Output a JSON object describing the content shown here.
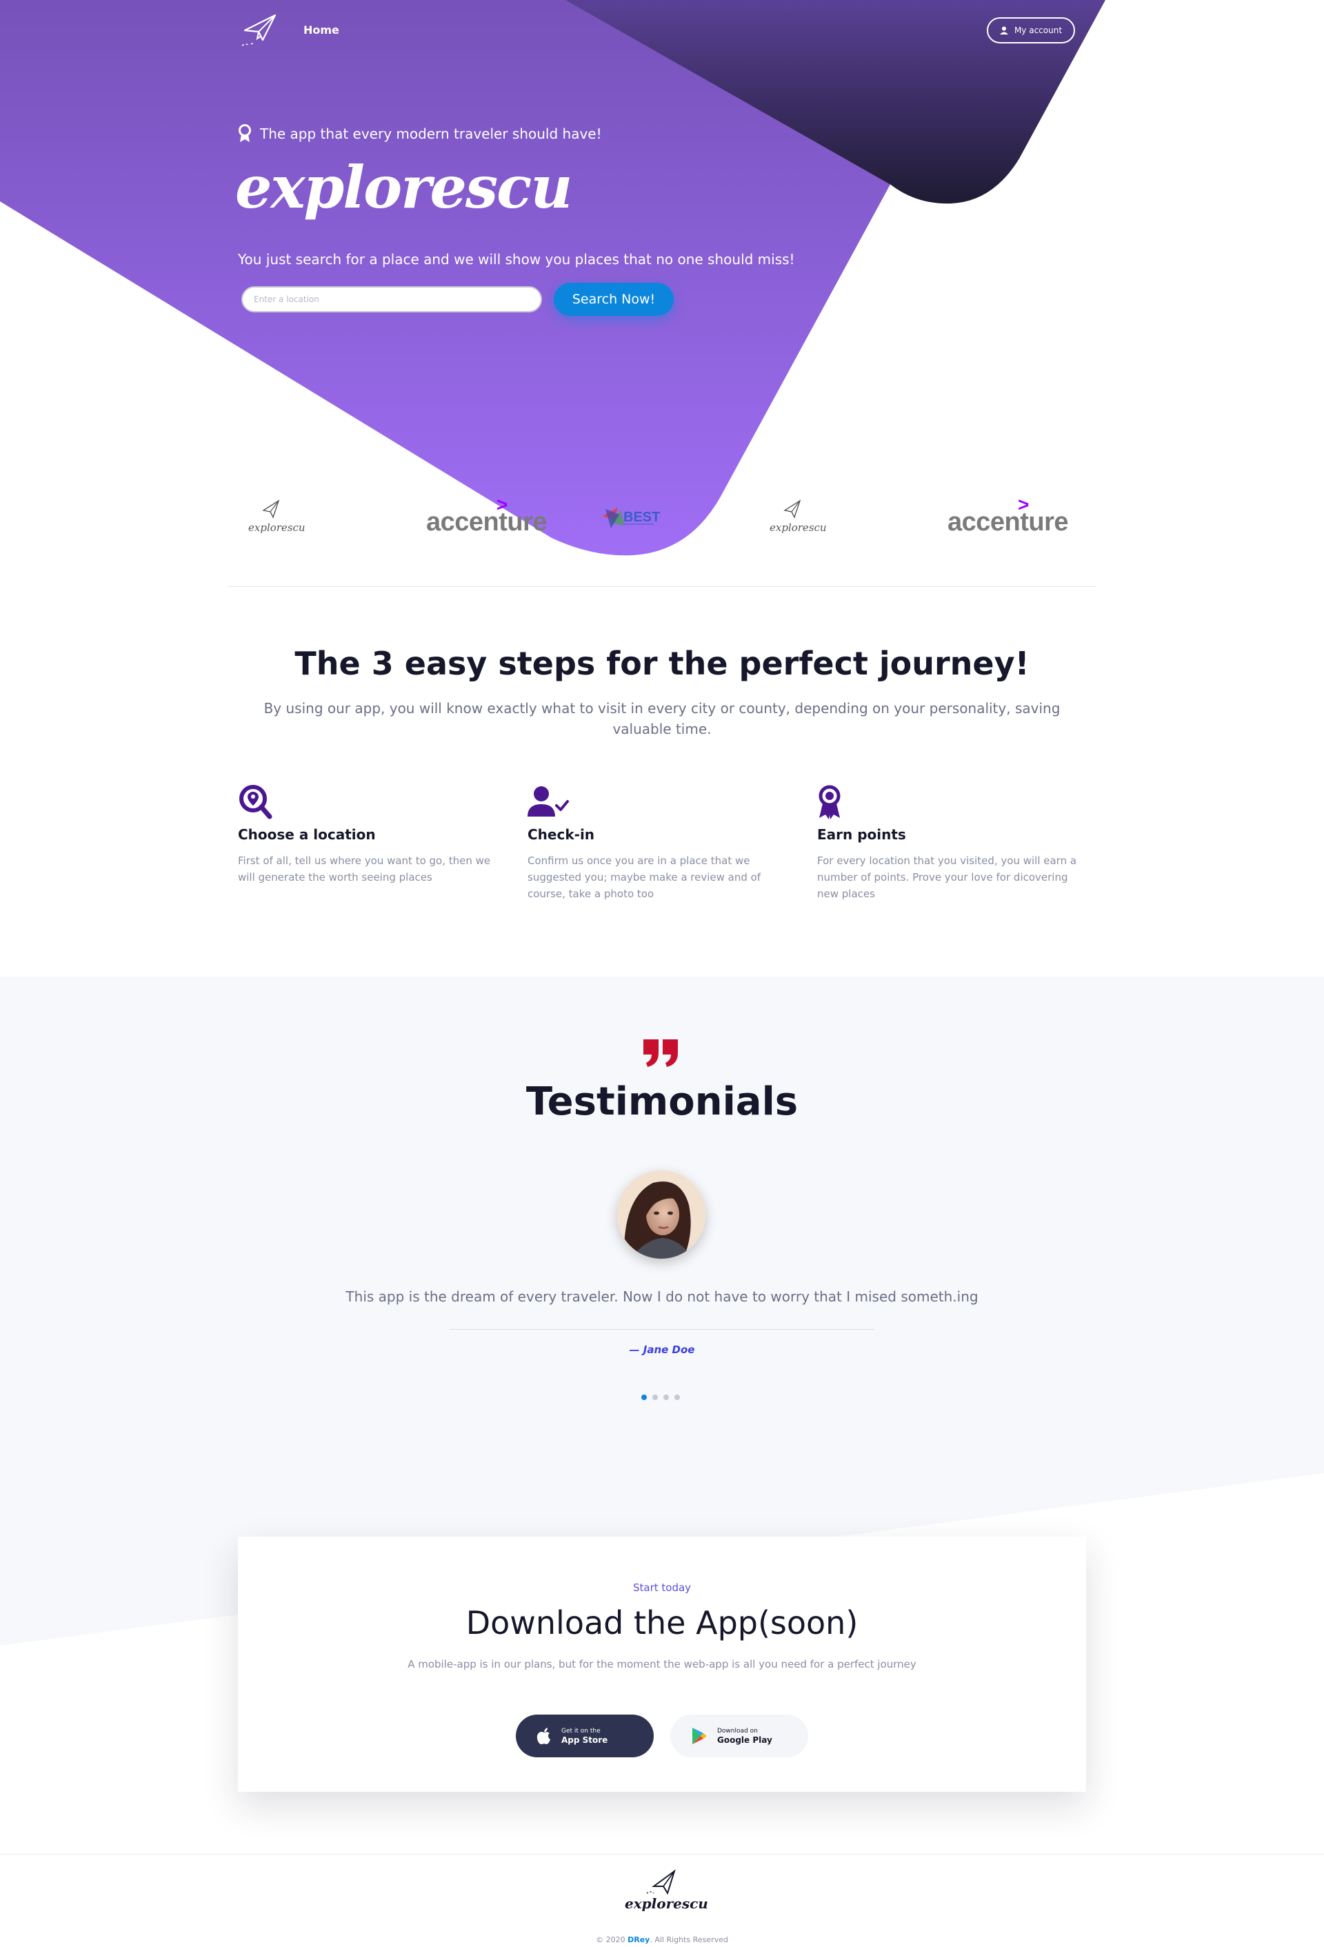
{
  "nav": {
    "home_label": "Home",
    "account_label": "My account"
  },
  "hero": {
    "tagline": "The app that every modern traveler should have!",
    "brand": "explorescu",
    "lead": "You just search for a place and we will show you places that no one should miss!",
    "search_placeholder": "Enter a location",
    "search_button": "Search Now!"
  },
  "partners": [
    {
      "name": "explorescu",
      "kind": "logo"
    },
    {
      "name": "accenture",
      "kind": "wordmark"
    },
    {
      "name": "BEST",
      "kind": "logo"
    },
    {
      "name": "explorescu",
      "kind": "logo"
    },
    {
      "name": "accenture",
      "kind": "wordmark"
    }
  ],
  "steps": {
    "title": "The 3 easy steps for the perfect journey!",
    "subtitle": "By using our app, you will know exactly what to visit in every city or county, depending on your personality, saving valuable time.",
    "items": [
      {
        "icon": "location-search-icon",
        "title": "Choose a location",
        "text": "First of all, tell us where you want to go, then we will generate the worth seeing places"
      },
      {
        "icon": "user-check-icon",
        "title": "Check-in",
        "text": "Confirm us once you are in a place that we suggested you; maybe make a review and of course, take a photo too"
      },
      {
        "icon": "award-ribbon-icon",
        "title": "Earn points",
        "text": "For every location that you visited, you will earn a number of points. Prove your love for dicovering new places"
      }
    ]
  },
  "testimonials": {
    "title": "Testimonials",
    "quote": "This app is the dream of every traveler. Now I do not have to worry that I mised someth.ing",
    "author": "— Jane Doe",
    "active_slide": 1,
    "slide_count": 4
  },
  "download": {
    "kicker": "Start today",
    "title": "Download the App(soon)",
    "subtitle": "A mobile-app is in our plans, but for the moment the web-app is all you need for a perfect journey",
    "apple_small": "Get it on the",
    "apple_big": "App Store",
    "google_small": "Download on",
    "google_big": "Google Play"
  },
  "footer": {
    "brand": "explorescu",
    "copy_prefix": "© 2020 ",
    "copy_owner": "DRey",
    "copy_suffix": ". All Rights Reserved"
  },
  "colors": {
    "hero_purple_top": "#7652b9",
    "hero_purple_bottom": "#a06ef5",
    "hero_dark": "#231f3c",
    "accent_blue": "#0b86dc",
    "icon_purple": "#4b1690",
    "quote_red": "#c8102e"
  }
}
